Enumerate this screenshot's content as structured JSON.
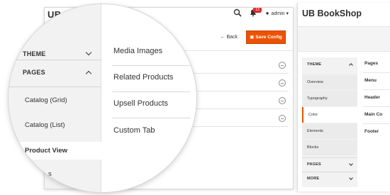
{
  "admin_panel": {
    "title": "UB",
    "header": {
      "notifications": "13",
      "user": "admin"
    },
    "toolbar": {
      "back_label": "Back",
      "save_label": "Save Config"
    }
  },
  "theme_panel": {
    "title": "UB BookShop",
    "nav": [
      {
        "label": "THEME",
        "kind": "header",
        "state": "expanded"
      },
      {
        "label": "Overview",
        "kind": "item"
      },
      {
        "label": "Typography",
        "kind": "item"
      },
      {
        "label": "Color",
        "kind": "item",
        "state": "active"
      },
      {
        "label": "Elements",
        "kind": "item"
      },
      {
        "label": "Blocks",
        "kind": "item"
      },
      {
        "label": "PAGES",
        "kind": "header",
        "state": "collapsed"
      },
      {
        "label": "MORE",
        "kind": "header",
        "state": "collapsed"
      }
    ],
    "fields": [
      "Pages",
      "Menu",
      "Header",
      "Main Co",
      "Footer"
    ]
  },
  "magnifier": {
    "nav": [
      {
        "label": "THEME",
        "kind": "header",
        "state": "collapsed"
      },
      {
        "label": "PAGES",
        "kind": "header",
        "state": "expanded"
      },
      {
        "label": "Catalog (Grid)",
        "kind": "item"
      },
      {
        "label": "Catalog (List)",
        "kind": "item"
      },
      {
        "label": "Product View",
        "kind": "item",
        "state": "active"
      },
      {
        "label": "s",
        "kind": "item"
      }
    ],
    "menu": [
      "Media Images",
      "Related Products",
      "Upsell Products",
      "Custom Tab"
    ]
  },
  "colors": {
    "accent": "#eb5202",
    "badge": "#e22626",
    "nav_bg": "#f2f2f2"
  }
}
